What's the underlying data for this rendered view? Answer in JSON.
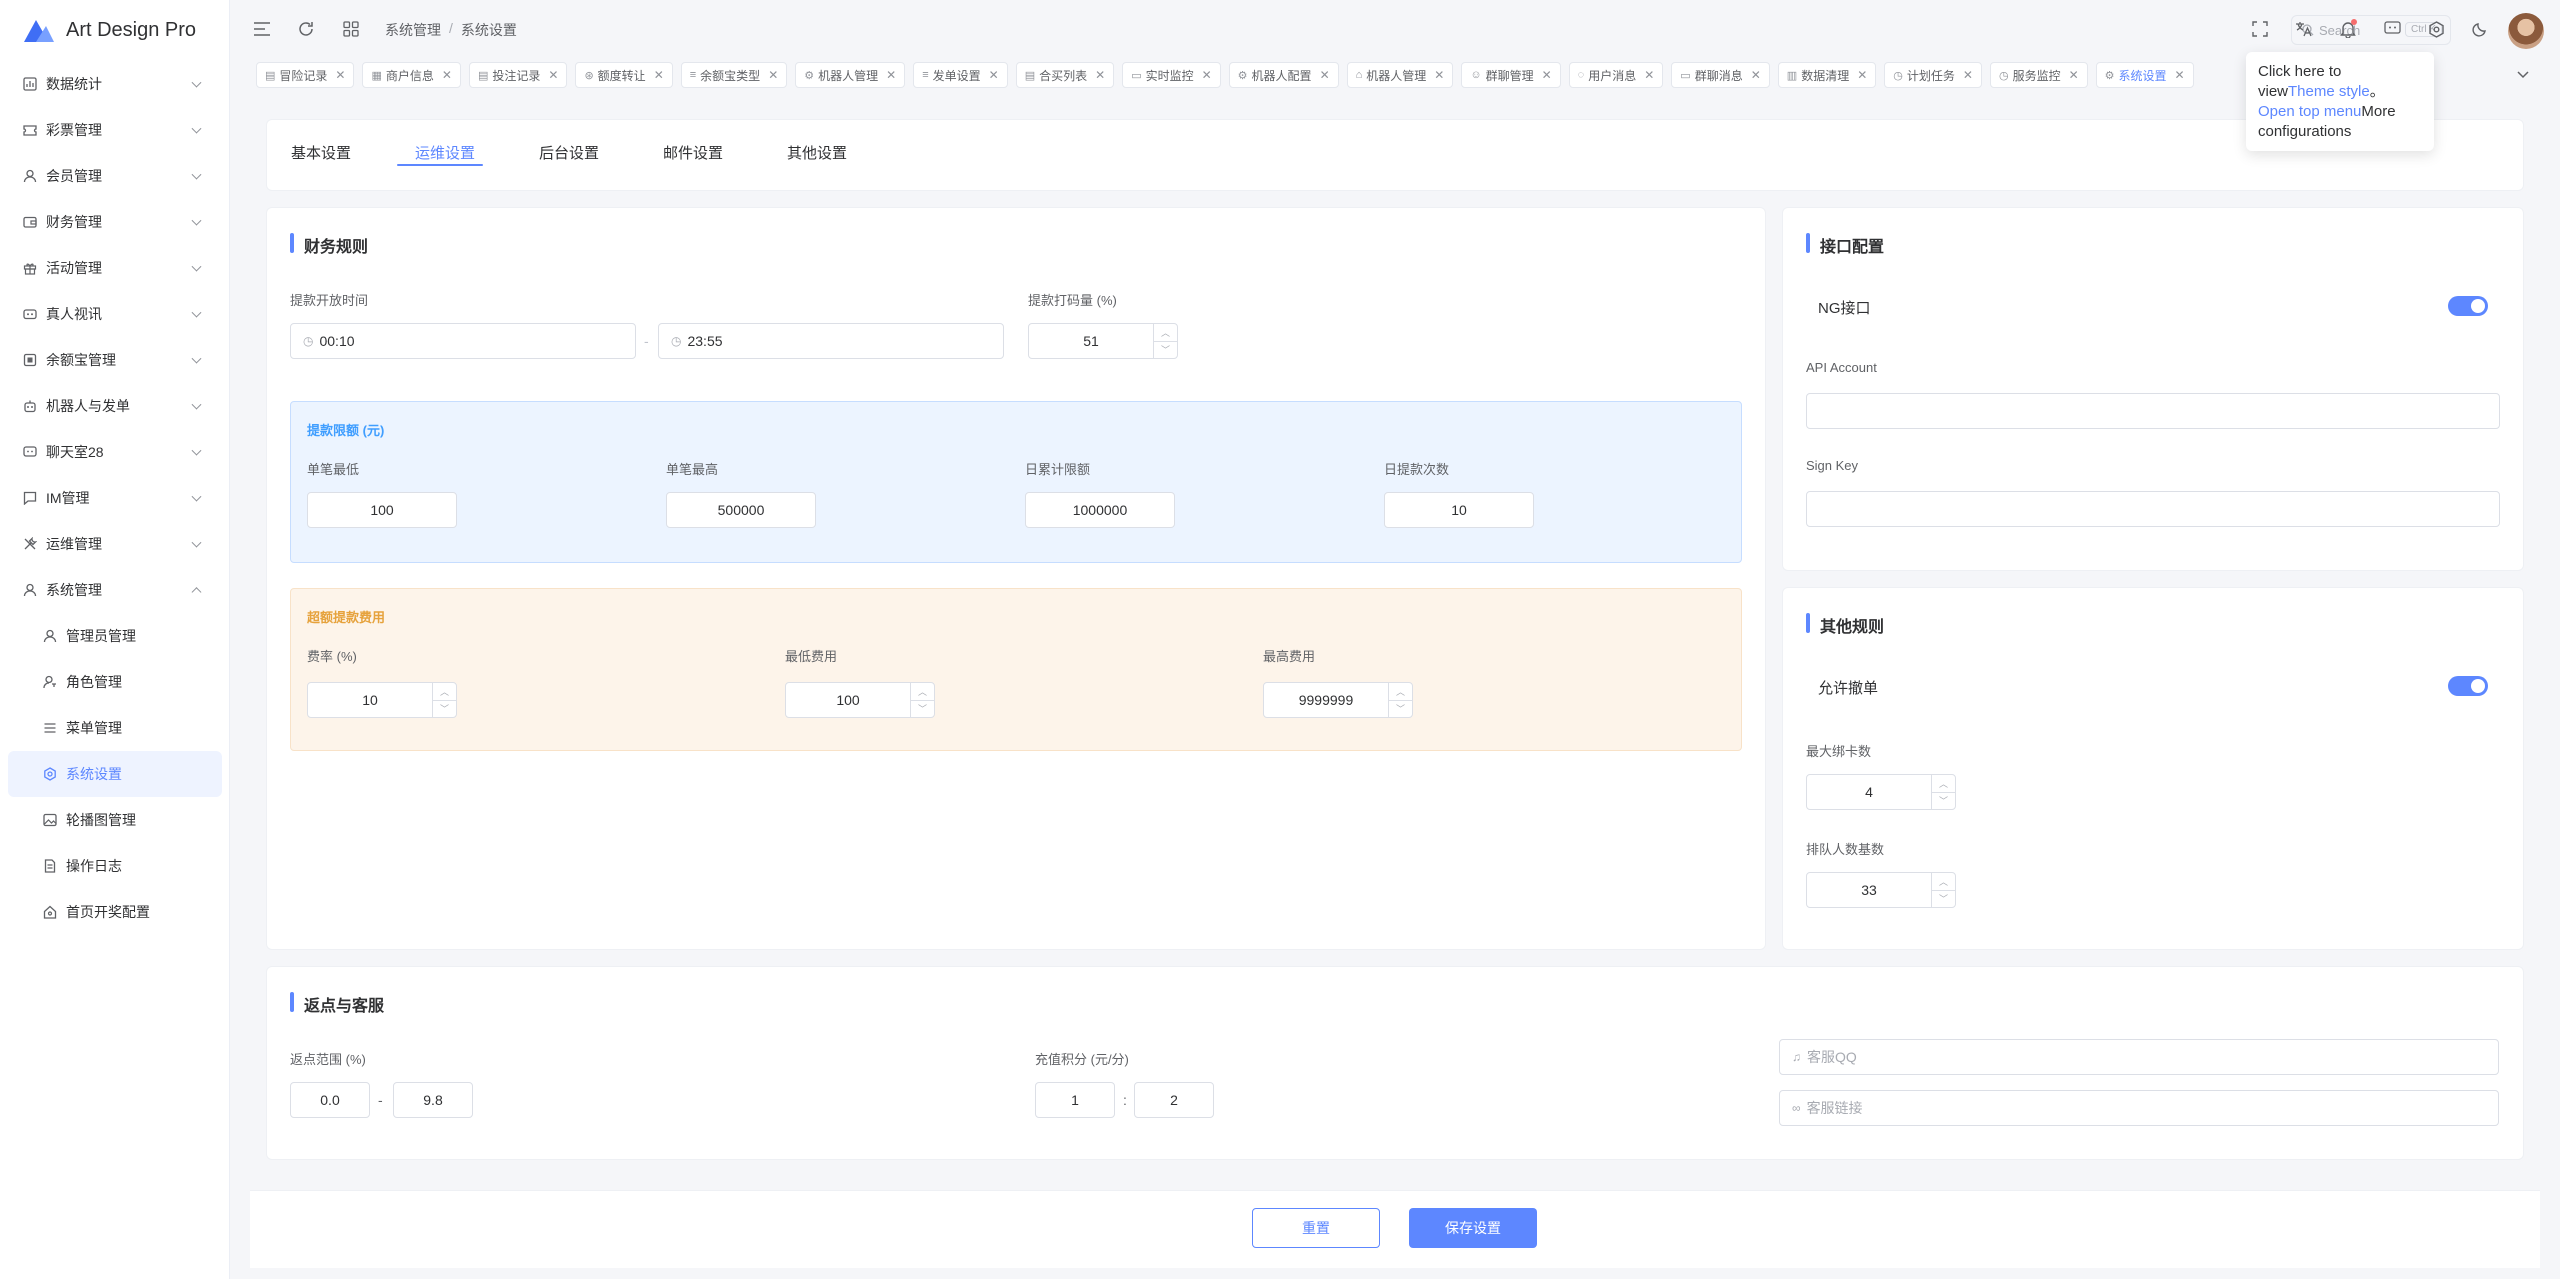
{
  "app": {
    "name": "Art Design Pro"
  },
  "sidebar": {
    "items": [
      {
        "label": "数据统计",
        "icon": "chart-icon"
      },
      {
        "label": "彩票管理",
        "icon": "ticket-icon"
      },
      {
        "label": "会员管理",
        "icon": "user-icon"
      },
      {
        "label": "财务管理",
        "icon": "wallet-icon"
      },
      {
        "label": "活动管理",
        "icon": "gift-icon"
      },
      {
        "label": "真人视讯",
        "icon": "video-icon"
      },
      {
        "label": "余额宝管理",
        "icon": "safe-icon"
      },
      {
        "label": "机器人与发单",
        "icon": "robot-icon"
      },
      {
        "label": "聊天室28",
        "icon": "chat-icon"
      },
      {
        "label": "IM管理",
        "icon": "message-icon"
      },
      {
        "label": "运维管理",
        "icon": "tools-icon"
      },
      {
        "label": "系统管理",
        "icon": "user-icon"
      }
    ],
    "sub_items": [
      {
        "label": "管理员管理",
        "icon": "user-icon"
      },
      {
        "label": "角色管理",
        "icon": "user-key-icon"
      },
      {
        "label": "菜单管理",
        "icon": "menu-icon"
      },
      {
        "label": "系统设置",
        "icon": "gear-icon"
      },
      {
        "label": "轮播图管理",
        "icon": "image-icon"
      },
      {
        "label": "操作日志",
        "icon": "document-icon"
      },
      {
        "label": "首页开奖配置",
        "icon": "home-icon"
      }
    ]
  },
  "header": {
    "breadcrumb": [
      "系统管理",
      "系统设置"
    ],
    "breadcrumb_sep": "/",
    "search_placeholder": "Search",
    "search_shortcut": "Ctrl K"
  },
  "tabs": [
    {
      "label": "冒险记录",
      "icon": "▤"
    },
    {
      "label": "商户信息",
      "icon": "▦"
    },
    {
      "label": "投注记录",
      "icon": "▤"
    },
    {
      "label": "额度转让",
      "icon": "⊛"
    },
    {
      "label": "余额宝类型",
      "icon": "≡"
    },
    {
      "label": "机器人管理",
      "icon": "⚙"
    },
    {
      "label": "发单设置",
      "icon": "≡"
    },
    {
      "label": "合买列表",
      "icon": "▤"
    },
    {
      "label": "实时监控",
      "icon": "▭"
    },
    {
      "label": "机器人配置",
      "icon": "⚙"
    },
    {
      "label": "机器人管理",
      "icon": "⌂"
    },
    {
      "label": "群聊管理",
      "icon": "☺"
    },
    {
      "label": "用户消息",
      "icon": "◌"
    },
    {
      "label": "群聊消息",
      "icon": "▭"
    },
    {
      "label": "数据清理",
      "icon": "▥"
    },
    {
      "label": "计划任务",
      "icon": "◷"
    },
    {
      "label": "服务监控",
      "icon": "◷"
    },
    {
      "label": "系统设置",
      "icon": "⚙"
    }
  ],
  "tooltip": {
    "p1": "Click here to view",
    "l1": "Theme style",
    "p2": "。",
    "l2": "Open top menu",
    "p3": "More configurations"
  },
  "settings_tabs": [
    "基本设置",
    "运维设置",
    "后台设置",
    "邮件设置",
    "其他设置"
  ],
  "finance": {
    "title": "财务规则",
    "withdraw_time_label": "提款开放时间",
    "time_start": "00:10",
    "time_end": "23:55",
    "time_sep": "-",
    "bet_ratio_label": "提款打码量 (%)",
    "bet_ratio": "51",
    "limits": {
      "title": "提款限额 (元)",
      "min_label": "单笔最低",
      "min": "100",
      "max_label": "单笔最高",
      "max": "500000",
      "daily_label": "日累计限额",
      "daily": "1000000",
      "count_label": "日提款次数",
      "count": "10"
    },
    "fees": {
      "title": "超额提款费用",
      "rate_label": "费率 (%)",
      "rate": "10",
      "min_label": "最低费用",
      "min": "100",
      "max_label": "最高费用",
      "max": "9999999"
    }
  },
  "api": {
    "title": "接口配置",
    "ng_label": "NG接口",
    "ng_enabled": true,
    "account_label": "API Account",
    "account": "",
    "key_label": "Sign Key",
    "key": ""
  },
  "other_rules": {
    "title": "其他规则",
    "cancel_label": "允许撤单",
    "cancel_enabled": true,
    "max_cards_label": "最大绑卡数",
    "max_cards": "4",
    "queue_label": "排队人数基数",
    "queue": "33"
  },
  "rebate": {
    "title": "返点与客服",
    "range_label": "返点范围 (%)",
    "range_min": "0.0",
    "range_max": "9.8",
    "range_sep": "-",
    "points_label": "充值积分 (元/分)",
    "points_a": "1",
    "points_b": "2",
    "points_sep": ":",
    "qq_placeholder": "客服QQ",
    "link_placeholder": "客服链接"
  },
  "footer": {
    "reset": "重置",
    "save": "保存设置"
  },
  "colors": {
    "primary": "#5d87ff",
    "blue_panel": "#ecf4ff",
    "orange_panel": "#fdf4ea"
  }
}
